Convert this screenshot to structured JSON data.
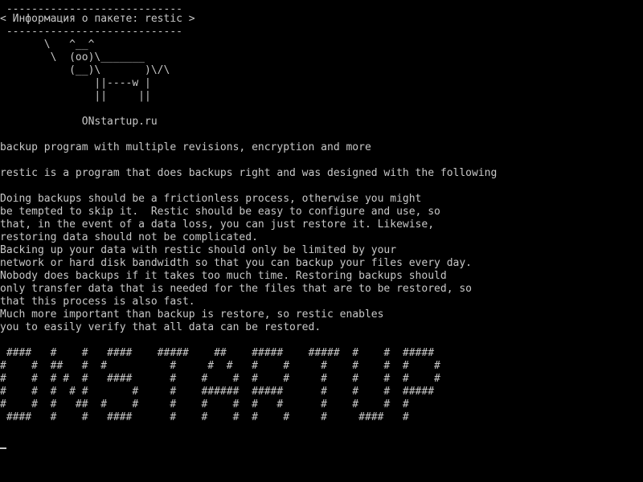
{
  "terminal": {
    "foreground": "#c8c8c8",
    "background": "#000000",
    "lines": [
      " ----------------------------",
      "< Информация о пакете: restic >",
      " ----------------------------",
      "       \\   ^__^",
      "        \\  (oo)\\_______",
      "           (__)\\       )\\/\\",
      "               ||----w |",
      "               ||     ||",
      "",
      "             ONstartup.ru",
      "",
      "backup program with multiple revisions, encryption and more",
      "",
      "restic is a program that does backups right and was designed with the following",
      "",
      "Doing backups should be a frictionless process, otherwise you might",
      "be tempted to skip it.  Restic should be easy to configure and use, so",
      "that, in the event of a data loss, you can just restore it. Likewise,",
      "restoring data should not be complicated.",
      "Backing up your data with restic should only be limited by your",
      "network or hard disk bandwidth so that you can backup your files every day.",
      "Nobody does backups if it takes too much time. Restoring backups should",
      "only transfer data that is needed for the files that are to be restored, so",
      "that this process is also fast.",
      "Much more important than backup is restore, so restic enables",
      "you to easily verify that all data can be restored.",
      "",
      " ####   #    #   ####    #####    ##    #####    #####  #    #  #####",
      "#    #  ##   #  #          #     #  #   #    #     #    #    #  #    #",
      "#    #  # #  #   ####      #    #    #  #    #     #    #    #  #    #",
      "#    #  #  # #       #     #    ######  #####      #    #    #  #####",
      "#    #  #   ##  #    #     #    #    #  #   #      #    #    #  #",
      " ####   #    #   ####      #    #    #  #    #     #     ####   #"
    ]
  }
}
